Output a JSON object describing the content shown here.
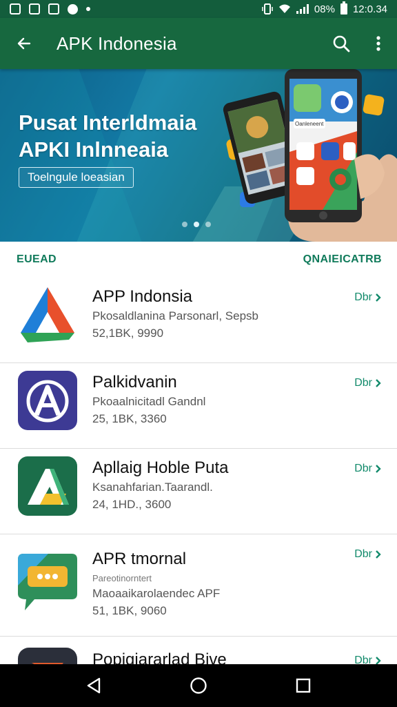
{
  "status_bar": {
    "battery": "08%",
    "time": "12:0.34"
  },
  "app_bar": {
    "title": "APK Indonesia"
  },
  "banner": {
    "title_line1": "Pusat Interldmaia",
    "title_line2": "APKI Inlnneaia",
    "button_label": "Toelngule loeasian",
    "phone_chip": "Oanleneent"
  },
  "section": {
    "left": "EUEAD",
    "right": "QNAIEICATRB"
  },
  "apps": [
    {
      "name": "APP Indonsia",
      "desc": "Pkosaldlanina Parsonarl, Sepsb",
      "sub": "",
      "meta": "52,1BK, 9990",
      "action": "Dbr"
    },
    {
      "name": "Palkidvanin",
      "desc": "Pkoaalnicitadl Gandnl",
      "sub": "",
      "meta": "25, 1BK, 3360",
      "action": "Dbr"
    },
    {
      "name": "Apllaig Hoble Puta",
      "desc": "Ksanahfarian.Taarandl.",
      "sub": "",
      "meta": "24, 1HD., 3600",
      "action": "Dbr"
    },
    {
      "name": "APR tmornal",
      "desc": "Maoaaikarolaendec APF",
      "sub": "Pareotinorntert",
      "meta": "51, 1BK, 9060",
      "action": "Dbr"
    },
    {
      "name": "Popigiararlad Bive",
      "desc": "",
      "sub": "",
      "meta": "",
      "action": "Dbr"
    }
  ],
  "colors": {
    "app_bar": "#17683f",
    "status_bar": "#135d3c",
    "accent": "#128a6b",
    "banner": "#137aa5"
  }
}
